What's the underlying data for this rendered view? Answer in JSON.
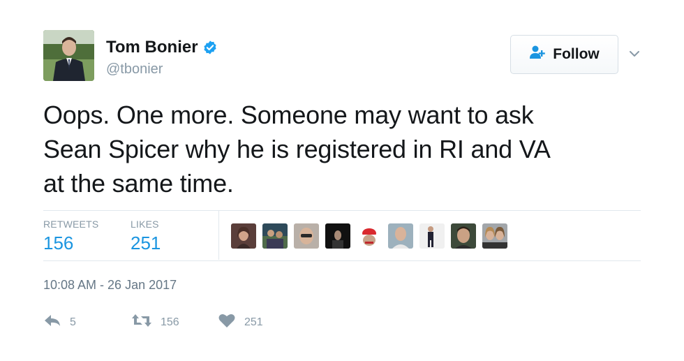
{
  "user": {
    "display_name": "Tom Bonier",
    "username": "@tbonier",
    "verified": true
  },
  "follow_button": {
    "label": "Follow"
  },
  "tweet": {
    "text_lines": [
      "Oops. One more. Someone may want to ask",
      "Sean Spicer why he is registered in RI and VA",
      "at the same time."
    ]
  },
  "stats": {
    "retweets_label": "RETWEETS",
    "retweets_value": "156",
    "likes_label": "LIKES",
    "likes_value": "251"
  },
  "timestamp": "10:08 AM - 26 Jan 2017",
  "actions": {
    "reply_count": "5",
    "retweet_count": "156",
    "like_count": "251"
  },
  "icons": {
    "verified": "verified-badge-icon",
    "follow": "follow-user-plus-icon",
    "caret": "chevron-down-icon",
    "reply": "reply-icon",
    "retweet": "retweet-icon",
    "like": "heart-icon"
  },
  "colors": {
    "link_blue": "#1b95e0",
    "verified_blue": "#1da1f2",
    "muted": "#8899a6",
    "follow_icon": "#1b95e0"
  }
}
